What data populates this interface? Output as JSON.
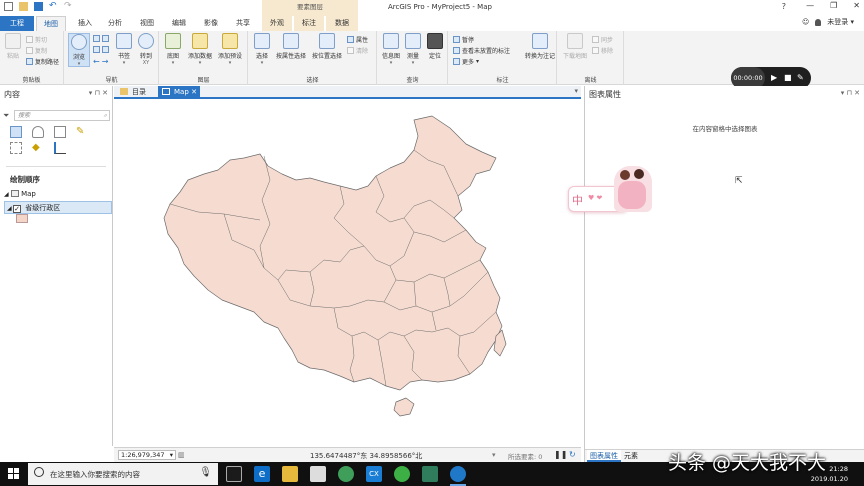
{
  "titlebar": {
    "context_group": "要素图层",
    "app_title": "ArcGIS Pro - MyProject5 - Map",
    "help": "?",
    "minimize": "—",
    "restore": "❐",
    "close": "✕"
  },
  "tabs": [
    {
      "label": "工程"
    },
    {
      "label": "地图"
    },
    {
      "label": "插入"
    },
    {
      "label": "分析"
    },
    {
      "label": "视图"
    },
    {
      "label": "编辑"
    },
    {
      "label": "影像"
    },
    {
      "label": "共享"
    },
    {
      "label": "外观"
    },
    {
      "label": "标注"
    },
    {
      "label": "数据"
    }
  ],
  "signin": {
    "label": "未登录 ▾",
    "emoji": "☺"
  },
  "ribbon": {
    "clipboard": {
      "group": "剪贴板",
      "paste": "粘贴",
      "cut": "剪切",
      "copy": "复制",
      "copy_path": "复制路径"
    },
    "navigate": {
      "group": "导航",
      "explore": "浏览",
      "bookmarks": "书签",
      "goto": "转到",
      "goto2": "XY"
    },
    "layer": {
      "group": "图层",
      "basemap": "底图",
      "add_data": "添加数据",
      "add_preset": "添加预设"
    },
    "selection": {
      "group": "选择",
      "select": "选择",
      "by_attr": "按属性选择",
      "by_loc": "按位置选择",
      "attributes": "属性",
      "clear": "清除"
    },
    "inquiry": {
      "group": "查询",
      "infographics": "信息图",
      "measure": "测量",
      "locate": "定位"
    },
    "labeling": {
      "group": "标注",
      "pause": "暂停",
      "view_unplaced": "查看未放置的标注",
      "more": "更多",
      "convert": "转换为注记"
    },
    "offline": {
      "group": "离线",
      "download": "下载地图",
      "sync": "同步",
      "remove": "移除"
    }
  },
  "contents_pane": {
    "title": "内容",
    "search_placeholder": "搜索",
    "drawing_order": "绘制顺序",
    "map_item": "Map",
    "layer_item": "省级行政区"
  },
  "doc_tabs": [
    {
      "label": "目录"
    },
    {
      "label": "Map"
    }
  ],
  "map_status": {
    "scale": "1:26,979,347",
    "coords": "135.6474487°东 34.8958566°北",
    "selected": "所选要素: 0"
  },
  "chart_pane": {
    "title": "图表属性",
    "hint": "在内容窗格中选择图表",
    "tabs": [
      {
        "label": "图表属性"
      },
      {
        "label": "元素"
      }
    ]
  },
  "recorder": {
    "time": "00:00:00"
  },
  "sticker": {
    "text": "中"
  },
  "taskbar": {
    "search": "在这里输入你要搜索的内容",
    "time": "21:28",
    "date": "2019.01.20",
    "apps": [
      "edge",
      "explorer",
      "store",
      "chrome",
      "cx",
      "wechat",
      "app",
      "arcgis"
    ]
  },
  "watermark": "头条 @天大我不大"
}
